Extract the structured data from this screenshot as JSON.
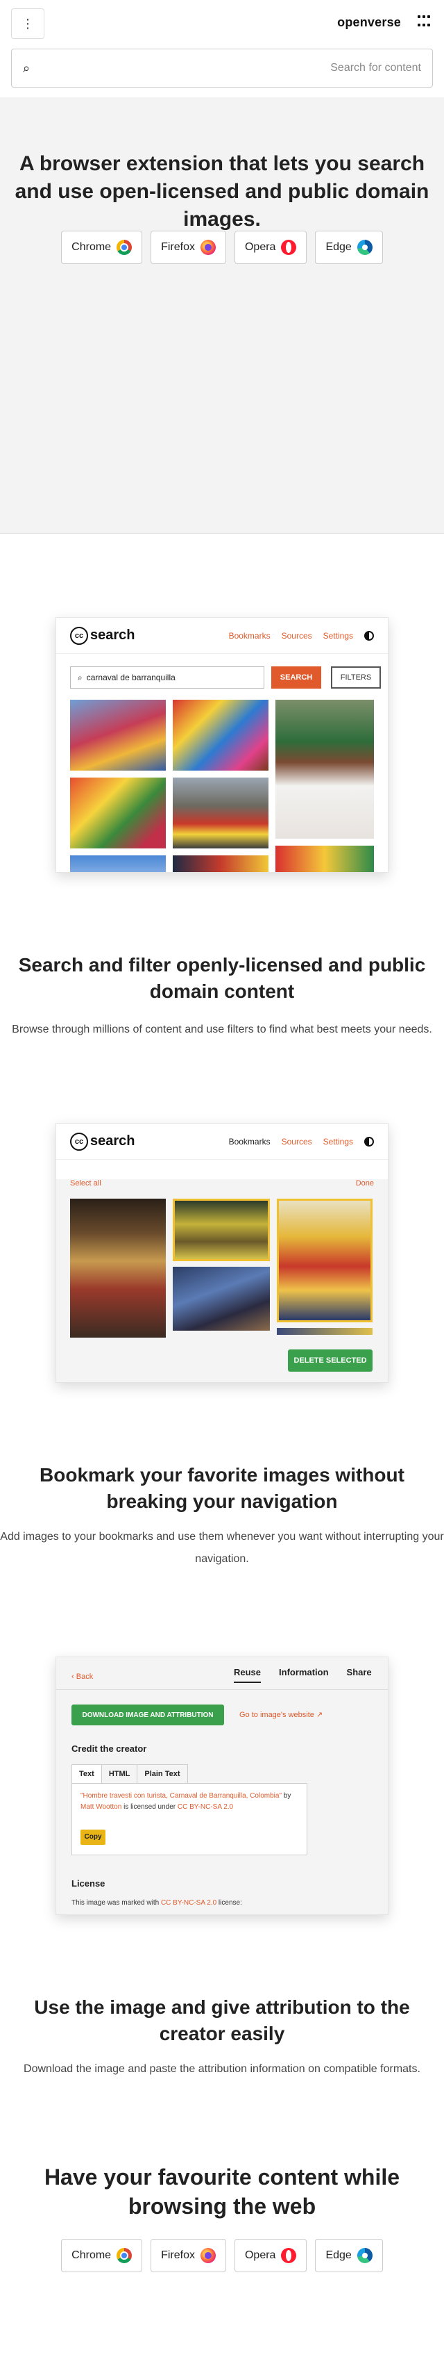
{
  "header": {
    "menu_icon": "⋮",
    "brand": "openverse",
    "search_placeholder": "Search for content"
  },
  "hero": {
    "title": "A browser extension that lets you search and use open-licensed and public domain images.",
    "browsers": [
      {
        "label": "Chrome",
        "icon": "chrome-icon"
      },
      {
        "label": "Firefox",
        "icon": "firefox-icon"
      },
      {
        "label": "Opera",
        "icon": "opera-icon"
      },
      {
        "label": "Edge",
        "icon": "edge-icon"
      }
    ]
  },
  "mock_search": {
    "logo_text": "search",
    "cc": "cc",
    "nav": [
      "Bookmarks",
      "Sources",
      "Settings"
    ],
    "query": "carnaval de barranquilla",
    "search_button": "SEARCH",
    "filters_button": "FILTERS",
    "colors": {
      "accent": "#e05a2b",
      "green": "#3aa04c"
    }
  },
  "section_search": {
    "title": "Search and filter openly-licensed and public domain content",
    "subtitle": "Browse through millions of content and use filters to find what best meets your needs."
  },
  "mock_bookmarks": {
    "logo_text": "search",
    "cc": "cc",
    "nav": [
      "Bookmarks",
      "Sources",
      "Settings"
    ],
    "select_all": "Select all",
    "done": "Done",
    "delete_button": "DELETE SELECTED"
  },
  "section_bookmarks": {
    "title": "Bookmark your favorite images without breaking your navigation",
    "subtitle": "Add images to your bookmarks and use them whenever you want without interrupting your navigation."
  },
  "mock_attribution": {
    "back": "Back",
    "tabs": [
      "Reuse",
      "Information",
      "Share"
    ],
    "download_button": "DOWNLOAD IMAGE AND ATTRIBUTION",
    "go_to_website": "Go to image's website",
    "credit_heading": "Credit the creator",
    "format_tabs": [
      "Text",
      "HTML",
      "Plain Text"
    ],
    "attribution_title": "\"Hombre travesti con turista, Carnaval de Barranquilla, Colombia\"",
    "attribution_by": " by ",
    "attribution_author": "Matt Wootton",
    "attribution_licensed": " is licensed under ",
    "attribution_license": "CC BY-NC-SA 2.0",
    "copy_button": "Copy",
    "license_heading": "License",
    "license_text_prefix": "This image was marked with ",
    "license_text_link": "CC BY-NC-SA 2.0",
    "license_text_suffix": " license:"
  },
  "section_attribution": {
    "title": "Use the image and give attribution to the creator easily",
    "subtitle": "Download the image and paste the attribution information on compatible formats."
  },
  "footer_cta": {
    "title": "Have your favourite content while browsing the web",
    "browsers": [
      {
        "label": "Chrome",
        "icon": "chrome-icon"
      },
      {
        "label": "Firefox",
        "icon": "firefox-icon"
      },
      {
        "label": "Opera",
        "icon": "opera-icon"
      },
      {
        "label": "Edge",
        "icon": "edge-icon"
      }
    ]
  }
}
